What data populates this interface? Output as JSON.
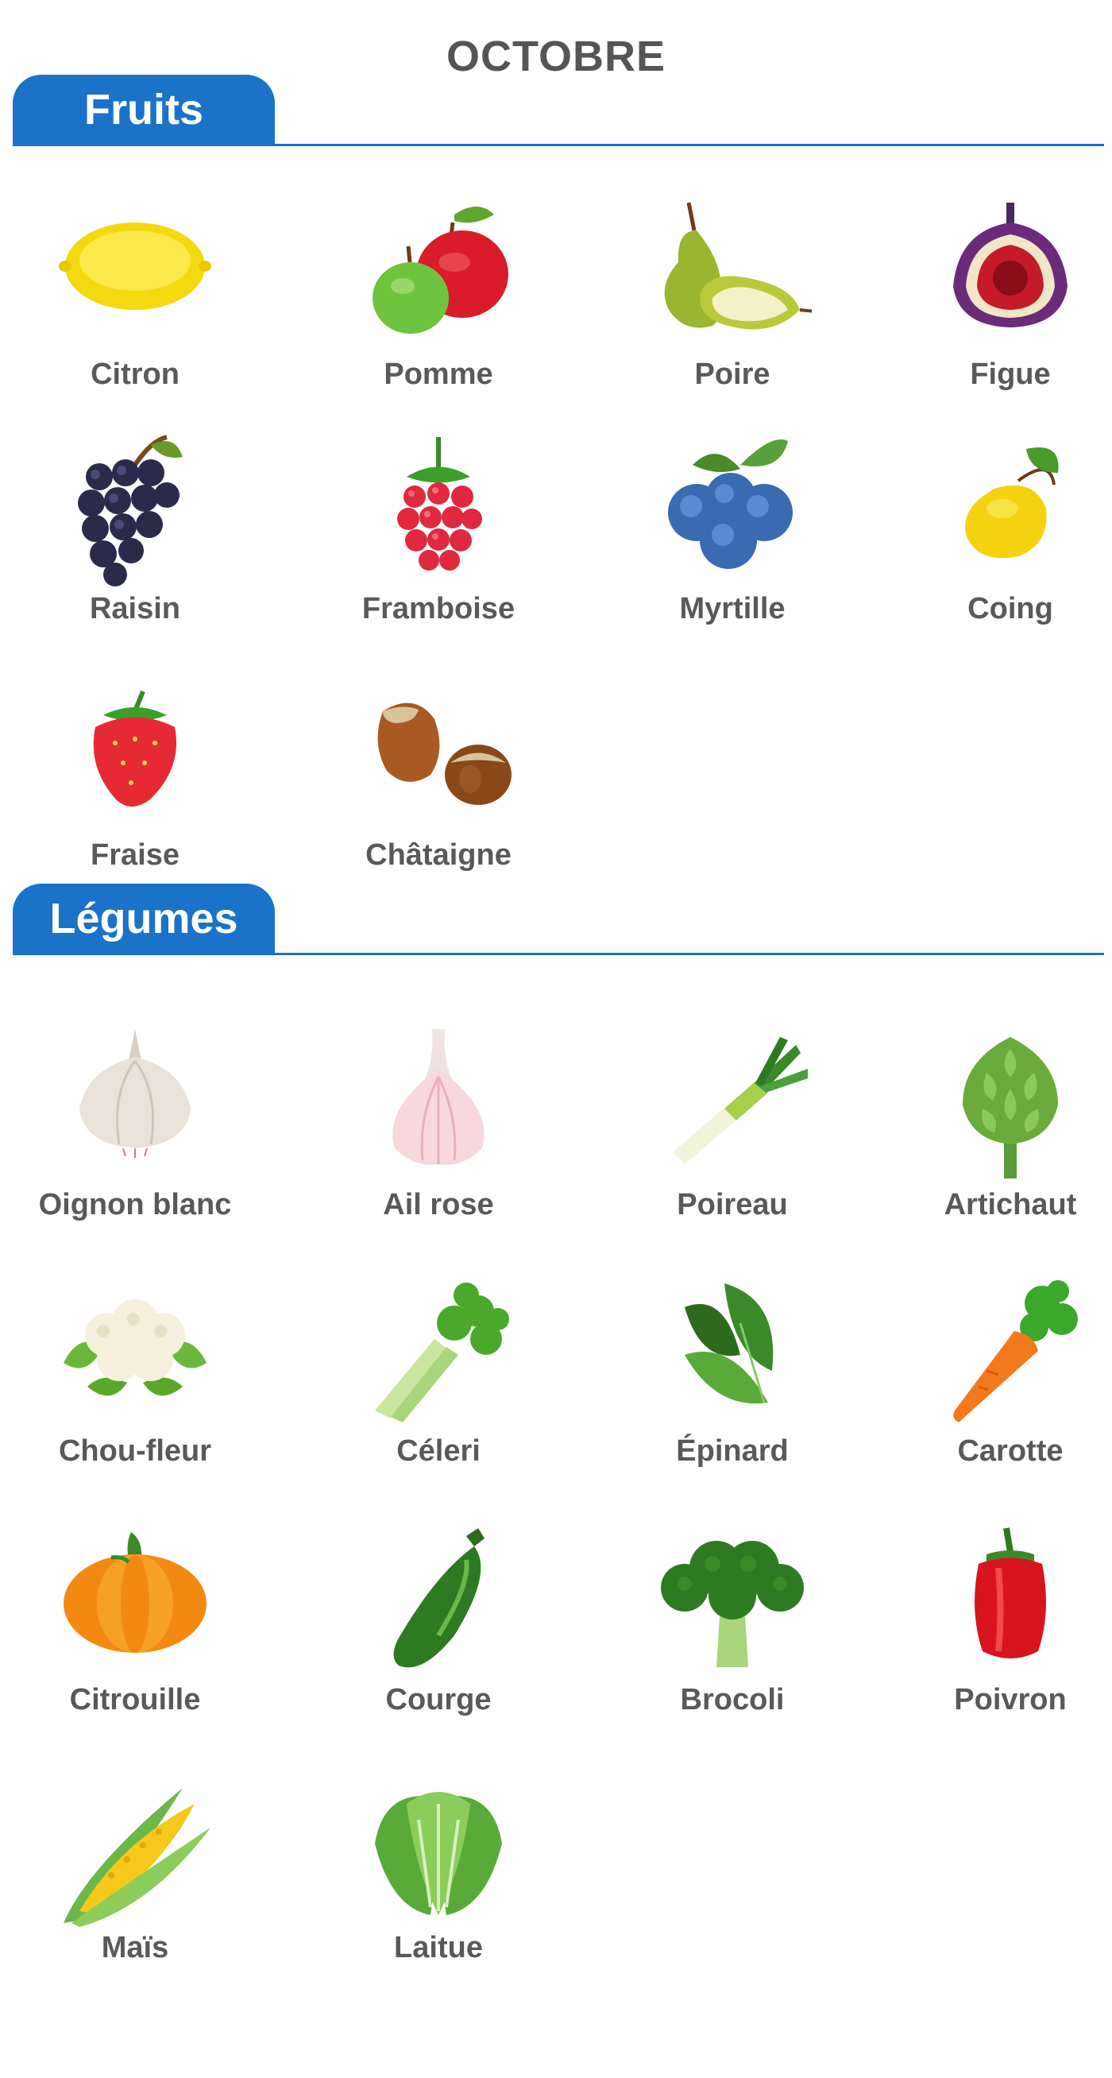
{
  "title": "OCTOBRE",
  "fruits": {
    "heading": "Fruits",
    "items": [
      {
        "label": "Citron",
        "icon": "lemon-icon"
      },
      {
        "label": "Pomme",
        "icon": "apple-icon"
      },
      {
        "label": "Poire",
        "icon": "pear-icon"
      },
      {
        "label": "Figue",
        "icon": "fig-icon"
      },
      {
        "label": "Raisin",
        "icon": "grapes-icon"
      },
      {
        "label": "Framboise",
        "icon": "raspberry-icon"
      },
      {
        "label": "Myrtille",
        "icon": "blueberry-icon"
      },
      {
        "label": "Coing",
        "icon": "quince-icon"
      },
      {
        "label": "Fraise",
        "icon": "strawberry-icon"
      },
      {
        "label": "Châtaigne",
        "icon": "chestnut-icon"
      }
    ]
  },
  "vegetables": {
    "heading": "Légumes",
    "items": [
      {
        "label": "Oignon blanc",
        "icon": "onion-icon"
      },
      {
        "label": "Ail rose",
        "icon": "garlic-icon"
      },
      {
        "label": "Poireau",
        "icon": "leek-icon"
      },
      {
        "label": "Artichaut",
        "icon": "artichoke-icon"
      },
      {
        "label": "Chou-fleur",
        "icon": "cauliflower-icon"
      },
      {
        "label": "Céleri",
        "icon": "celery-icon"
      },
      {
        "label": "Épinard",
        "icon": "spinach-icon"
      },
      {
        "label": "Carotte",
        "icon": "carrot-icon"
      },
      {
        "label": "Citrouille",
        "icon": "pumpkin-icon"
      },
      {
        "label": "Courge",
        "icon": "zucchini-icon"
      },
      {
        "label": "Brocoli",
        "icon": "broccoli-icon"
      },
      {
        "label": "Poivron",
        "icon": "bell-pepper-icon"
      },
      {
        "label": "Maïs",
        "icon": "corn-icon"
      },
      {
        "label": "Laitue",
        "icon": "lettuce-icon"
      }
    ]
  },
  "colors": {
    "accent": "#1a73c8",
    "text": "#59595c"
  }
}
